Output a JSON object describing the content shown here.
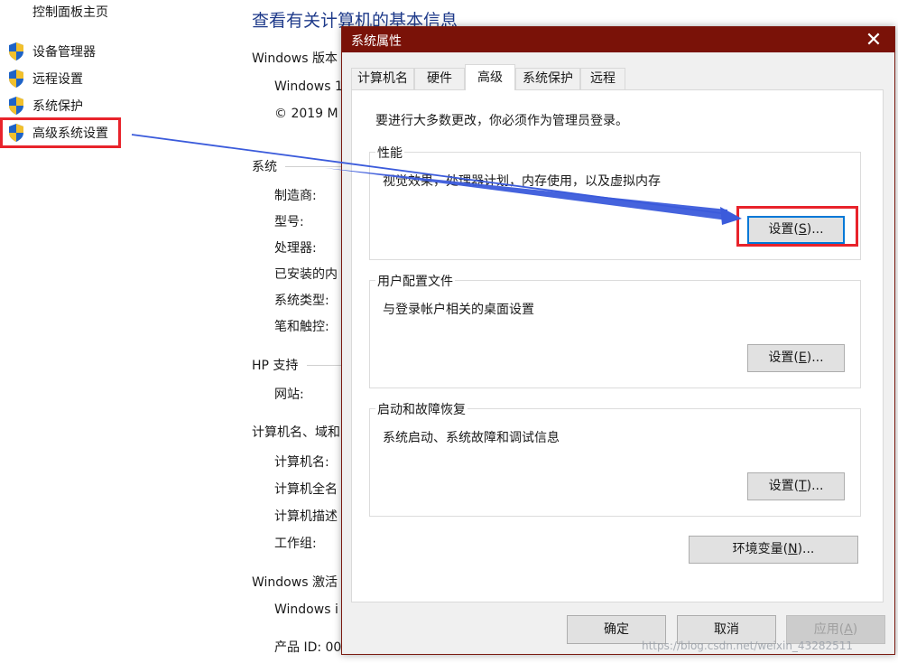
{
  "control_panel": {
    "home_link": "控制面板主页",
    "side_items": [
      "设备管理器",
      "远程设置",
      "系统保护",
      "高级系统设置"
    ],
    "page_title": "查看有关计算机的基本信息",
    "windows_edition_heading": "Windows 版本",
    "windows_edition_line1": "Windows 1",
    "windows_edition_line2": "© 2019 M",
    "system_heading": "系统",
    "system_labels": [
      "制造商:",
      "型号:",
      "处理器:",
      "已安装的内",
      "系统类型:",
      "笔和触控:"
    ],
    "hp_support_heading": "HP 支持",
    "website_label": "网站:",
    "computer_name_heading": "计算机名、域和",
    "computer_labels": [
      "计算机名:",
      "计算机全名",
      "计算机描述",
      "工作组:"
    ],
    "activation_heading": "Windows 激活",
    "activation_line1": "Windows i",
    "product_id": "产品 ID: 00"
  },
  "dialog": {
    "title": "系统属性",
    "close_glyph": "✕",
    "tabs": [
      "计算机名",
      "硬件",
      "高级",
      "系统保护",
      "远程"
    ],
    "active_tab_index": 2,
    "admin_note": "要进行大多数更改，你必须作为管理员登录。",
    "performance": {
      "title": "性能",
      "desc": "视觉效果，处理器计划，内存使用，以及虚拟内存",
      "button_pre": "设置(",
      "button_key": "S",
      "button_post": ")..."
    },
    "user_profiles": {
      "title": "用户配置文件",
      "desc": "与登录帐户相关的桌面设置",
      "button_pre": "设置(",
      "button_key": "E",
      "button_post": ")..."
    },
    "startup_recovery": {
      "title": "启动和故障恢复",
      "desc": "系统启动、系统故障和调试信息",
      "button_pre": "设置(",
      "button_key": "T",
      "button_post": ")..."
    },
    "env_button_pre": "环境变量(",
    "env_button_key": "N",
    "env_button_post": ")...",
    "ok_label": "确定",
    "cancel_label": "取消",
    "apply_pre": "应用(",
    "apply_key": "A",
    "apply_post": ")"
  },
  "annotation": {
    "highlight_color": "#e8232b",
    "arrow_color": "#3b5bdb"
  },
  "watermark": "https://blog.csdn.net/weixin_43282511"
}
